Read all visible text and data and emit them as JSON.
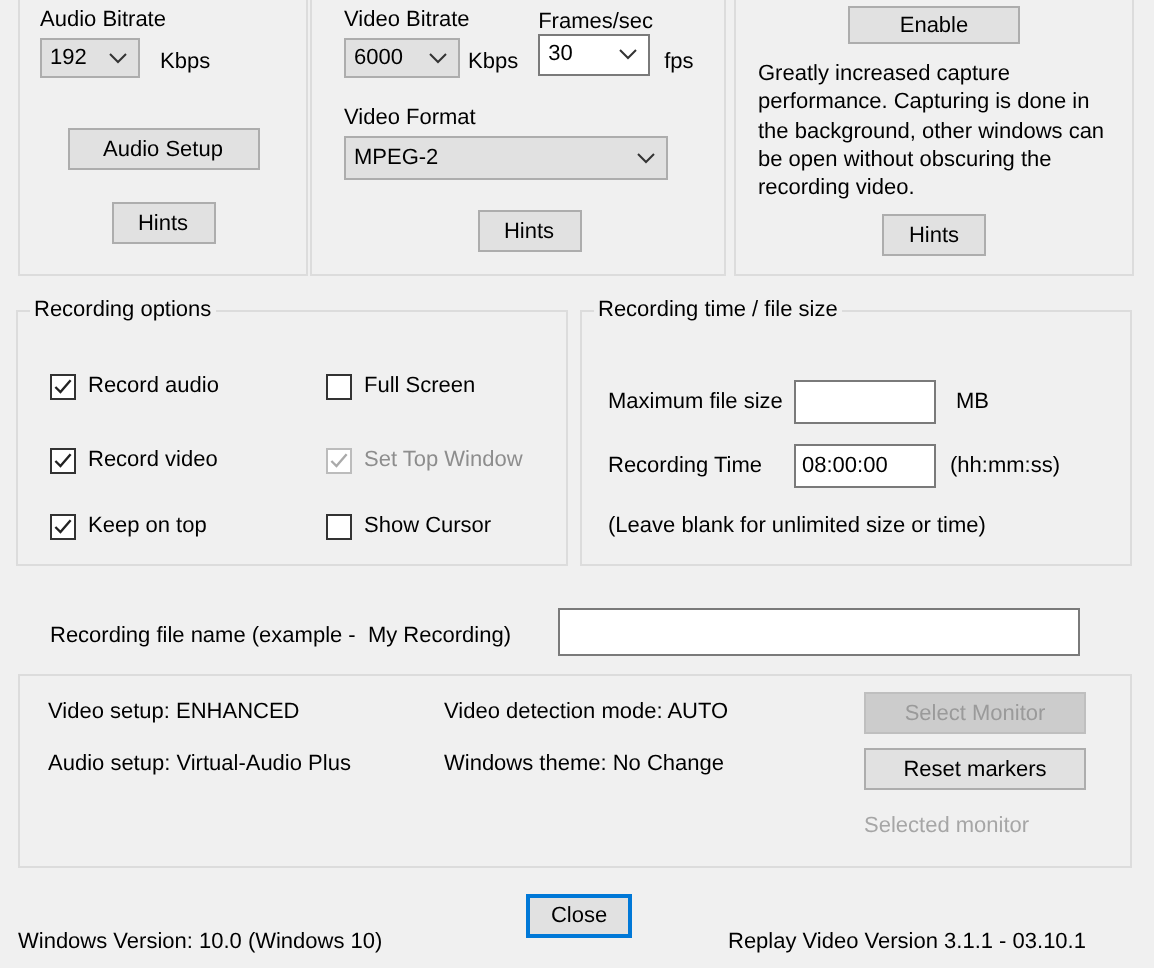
{
  "audio": {
    "bitrate_label": "Audio Bitrate",
    "bitrate": {
      "value": "192",
      "editable": false
    },
    "unit": "Kbps",
    "setup_button": "Audio Setup",
    "hints_button": "Hints"
  },
  "video": {
    "bitrate_label": "Video Bitrate",
    "bitrate": {
      "value": "6000",
      "editable": false
    },
    "bitrate_unit": "Kbps",
    "fps_label": "Frames/sec",
    "fps": {
      "value": "30",
      "editable": true
    },
    "fps_unit": "fps",
    "format_label": "Video Format",
    "format": {
      "value": "MPEG-2",
      "editable": false
    },
    "hints_button": "Hints"
  },
  "capture": {
    "enable_button": "Enable",
    "description": "Greatly increased capture performance. Capturing is done in the background, other windows can be open without obscuring the recording video.",
    "hints_button": "Hints"
  },
  "recording_options": {
    "title": "Recording options",
    "options": [
      {
        "label": "Record audio",
        "checked": true,
        "disabled": false
      },
      {
        "label": "Full Screen",
        "checked": false,
        "disabled": false
      },
      {
        "label": "Record video",
        "checked": true,
        "disabled": false
      },
      {
        "label": "Set Top Window",
        "checked": true,
        "disabled": true
      },
      {
        "label": "Keep on top",
        "checked": true,
        "disabled": false
      },
      {
        "label": "Show Cursor",
        "checked": false,
        "disabled": false
      }
    ]
  },
  "recording_limits": {
    "title": "Recording time / file size",
    "max_size_label": "Maximum file size",
    "max_size_unit": "MB",
    "time_label": "Recording Time",
    "time_value": "08:00:00",
    "time_unit": "(hh:mm:ss)",
    "note": "(Leave blank for unlimited size or time)"
  },
  "file_name": {
    "label": "Recording file name (example -  My Recording)"
  },
  "status": {
    "video_setup": "Video setup: ENHANCED",
    "video_detection": "Video detection mode: AUTO",
    "audio_setup": "Audio setup: Virtual-Audio Plus",
    "windows_theme": "Windows theme: No Change",
    "buttons": [
      {
        "label": "Select Monitor",
        "disabled": true
      },
      {
        "label": "Reset markers",
        "disabled": false
      }
    ],
    "selected_monitor": "Selected monitor"
  },
  "close_button": "Close",
  "footer": {
    "windows_version": "Windows Version: 10.0 (Windows 10)",
    "app_version": "Replay Video Version 3.1.1 - 03.10.1"
  }
}
